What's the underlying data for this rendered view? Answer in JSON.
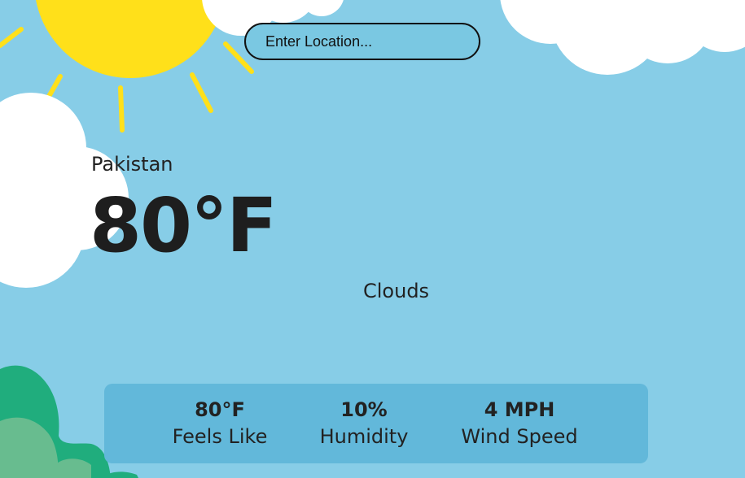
{
  "app": {
    "search": {
      "placeholder": "Enter Location..."
    },
    "location": "Pakistan",
    "temperature": "80°F",
    "condition": "Clouds",
    "stats": {
      "feels_like_value": "80°F",
      "feels_like_label": "Feels Like",
      "humidity_value": "10%",
      "humidity_label": "Humidity",
      "wind_value": "4 MPH",
      "wind_label": "Wind Speed"
    }
  },
  "colors": {
    "sky": "#87cde7",
    "sun": "#ffe01a",
    "cloud": "#ffffff",
    "bush_dark": "#20ad7d",
    "bush_light": "#68bc8f",
    "stats_panel": "#62b8da"
  },
  "icons": [
    "sun-icon",
    "cloud-icon",
    "bush-icon"
  ]
}
